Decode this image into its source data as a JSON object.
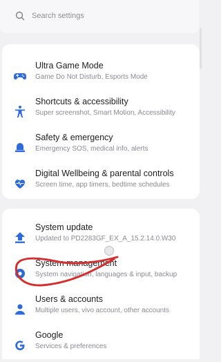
{
  "search": {
    "placeholder": "Search settings"
  },
  "group1": [
    {
      "title": "Ultra Game Mode",
      "subtitle": "Game Do Not Disturb, Esports Mode",
      "icon": "gamepad-icon"
    },
    {
      "title": "Shortcuts & accessibility",
      "subtitle": "Super screenshot, Smart Motion, Accessibility",
      "icon": "accessibility-icon"
    },
    {
      "title": "Safety & emergency",
      "subtitle": "Emergency SOS, medical info, alerts",
      "icon": "bell-icon"
    },
    {
      "title": "Digital Wellbeing & parental controls",
      "subtitle": "Screen time, app timers, bedtime schedules",
      "icon": "heart-icon"
    }
  ],
  "group2": [
    {
      "title": "System update",
      "subtitle": "Updated to PD2283GF_EX_A_15.2.14.0.W30",
      "icon": "update-arrow-icon"
    },
    {
      "title": "System management",
      "subtitle": "System navigation, languages & input, backup",
      "icon": "settings-gear-icon"
    },
    {
      "title": "Users & accounts",
      "subtitle": "Multiple users, vivo account, other accounts",
      "icon": "user-icon"
    },
    {
      "title": "Google",
      "subtitle": "Services & preferences",
      "icon": "google-icon"
    }
  ],
  "colors": {
    "icon": "#2f6bd8",
    "annotation": "#d32f2f"
  }
}
